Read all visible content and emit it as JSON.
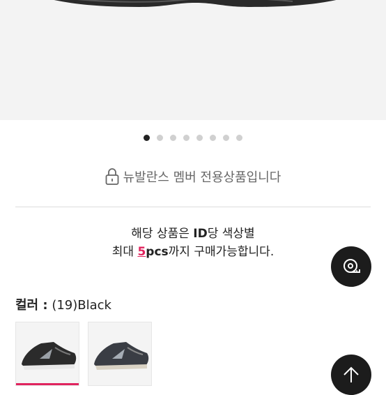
{
  "gallery": {
    "total": 8,
    "active": 0
  },
  "notice": {
    "member_only": "뉴발란스 멤버 전용상품입니다"
  },
  "limit": {
    "line1_pre": "해당 상품은 ",
    "line1_bold": "ID",
    "line1_post": "당 색상별",
    "line2_pre": "최대 ",
    "line2_num": "5",
    "line2_unit": "pcs",
    "line2_post": "까지 구매가능합니다."
  },
  "color": {
    "key": "컬러 :",
    "value": "(19)Black"
  },
  "swatches": [
    {
      "name": "black-grey",
      "selected": true
    },
    {
      "name": "black-grey-2",
      "selected": false
    }
  ],
  "colors": {
    "accent": "#e0245e",
    "button_bg": "#1c1c1c",
    "dot_active": "#222222",
    "dot_inactive": "#d0d0d0"
  },
  "icons": {
    "lock": "lock-icon",
    "measure": "tape-measure-icon",
    "top": "arrow-up-icon"
  }
}
